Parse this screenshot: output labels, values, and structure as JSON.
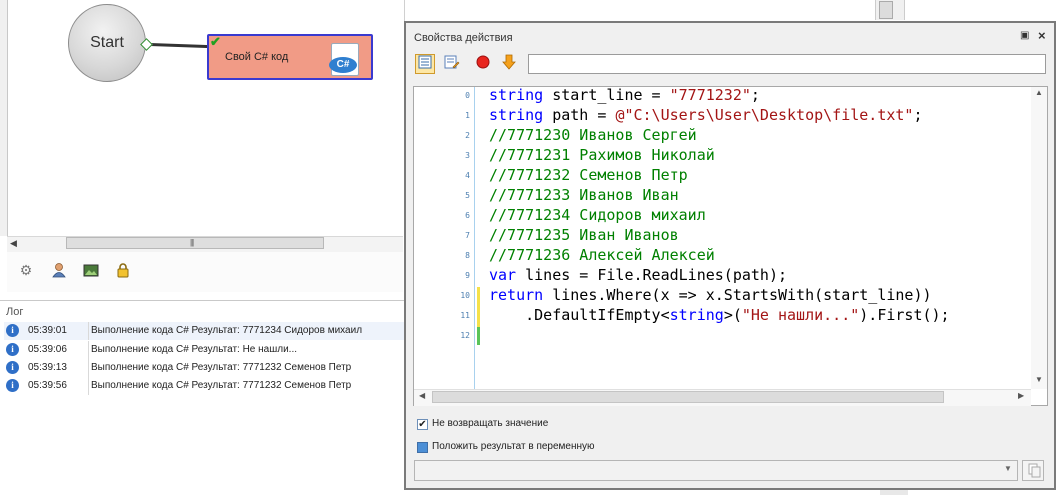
{
  "canvas": {
    "start_node_label": "Start",
    "action_node_label": "Свой C# код",
    "action_icon_badge": "C#",
    "toolbar_icons": [
      "gear-icon",
      "user-icon",
      "picture-icon",
      "lock-icon"
    ]
  },
  "log": {
    "title": "Лог",
    "entries": [
      {
        "time": "05:39:01",
        "message": "Выполнение кода C#  Результат: 7771234 Сидоров михаил"
      },
      {
        "time": "05:39:06",
        "message": "Выполнение кода C#  Результат: Не нашли..."
      },
      {
        "time": "05:39:13",
        "message": "Выполнение кода C#  Результат: 7771232 Семенов Петр"
      },
      {
        "time": "05:39:56",
        "message": "Выполнение кода C#  Результат: 7771232 Семенов Петр"
      }
    ],
    "info_icon_glyph": "i"
  },
  "dialog": {
    "title": "Свойства действия",
    "input_value": "",
    "code": {
      "line_numbers": [
        "0",
        "1",
        "2",
        "3",
        "4",
        "5",
        "6",
        "7",
        "8",
        "9",
        "10",
        "11",
        "12"
      ],
      "l0": {
        "kw": "string",
        "rest": " start_line = ",
        "str": "\"7771232\"",
        "end": ";"
      },
      "l1": {
        "kw": "string",
        "rest": " path = ",
        "str": "@\"C:\\Users\\User\\Desktop\\file.txt\"",
        "end": ";"
      },
      "l2": "//7771230 Иванов Сергей",
      "l3": "//7771231 Рахимов Николай",
      "l4": "//7771232 Семенов Петр",
      "l5": "//7771233 Иванов Иван",
      "l6": "//7771234 Сидоров михаил",
      "l7": "//7771235 Иван Иванов",
      "l8": "//7771236 Алексей Алексей",
      "l9": {
        "kw": "var",
        "rest": " lines = File.ReadLines(path);"
      },
      "l10": {
        "kw": "return",
        "rest": " lines.Where(x => x.StartsWith(start_line))"
      },
      "l11": {
        "a": "    .DefaultIfEmpty<",
        "kw": "string",
        "b": ">(",
        "str": "\"Не нашли...\"",
        "c": ").First();"
      }
    },
    "checkbox_no_return": {
      "label": "Не возвращать значение",
      "checked": true
    },
    "checkbox_put_result": {
      "label": "Положить результат в переменную",
      "checked": false
    },
    "result_variable_value": ""
  }
}
